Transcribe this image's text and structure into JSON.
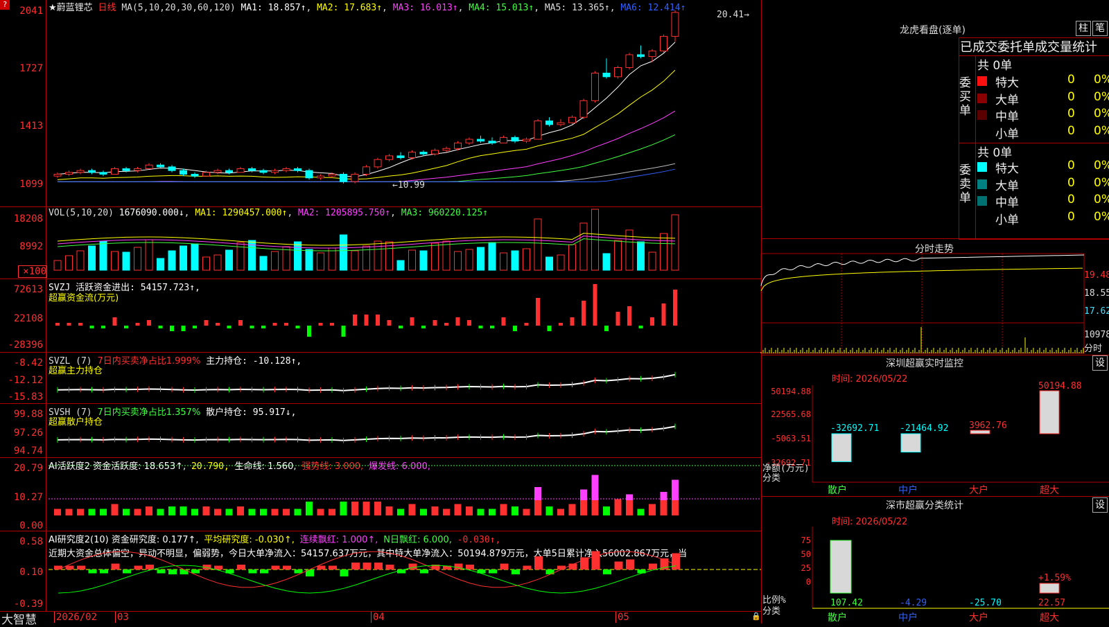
{
  "header": {
    "stock_name": "★蔚蓝锂芯",
    "period": "日线",
    "ma_label": "MA(5,10,20,30,60,120)",
    "ma1": "MA1: 18.857↑",
    "ma2": "MA2: 17.683↑",
    "ma3": "MA3: 16.013↑",
    "ma4": "MA4: 15.013↑",
    "ma5": "MA5: 13.365↑",
    "ma6": "MA6: 12.414↑",
    "high_marker": "20.41",
    "low_marker": "10.99"
  },
  "price_axis": [
    "2041",
    "1727",
    "1413",
    "1099"
  ],
  "vol": {
    "title": "VOL(5,10,20)",
    "value": "1676090.000↓",
    "ma1": "MA1: 1290457.000↑",
    "ma2": "MA2: 1205895.750↑",
    "ma3": "MA3: 960220.125↑",
    "axis": [
      "18208",
      "8992",
      "×100"
    ]
  },
  "svzj": {
    "title": "SVZJ  活跃资金进出: 54157.723↑,",
    "subtitle": "超赢资金流(万元)",
    "axis": [
      "72613",
      "22108",
      "-28396"
    ]
  },
  "svzl": {
    "title": "SVZL (7)",
    "green": "7日内买卖净占比1.999%",
    "white": "主力持仓: -10.128↑,",
    "subtitle": "超赢主力持仓",
    "axis": [
      "-8.42",
      "-12.12",
      "-15.83"
    ]
  },
  "svsh": {
    "title": "SVSH (7)",
    "green": "7日内买卖净占比1.357%",
    "white": "散户持仓: 95.917↓,",
    "subtitle": "超赢散户持仓",
    "axis": [
      "99.88",
      "97.26",
      "94.74"
    ]
  },
  "ai_active": {
    "title": "AI活跃度2 资金活跃度: 18.653↑,",
    "v2": "20.790,",
    "v3": "生命线: 1.560,",
    "v4": "强势线: 3.000,",
    "v5": "爆发线: 6.000,",
    "axis": [
      "20.79",
      "10.27",
      "0.00"
    ]
  },
  "ai_research": {
    "title": "AI研究度2(10) 资金研究度: 0.177↑,",
    "v2": "平均研究度: -0.030↑,",
    "v3": "连续飘红: 1.000↑,",
    "v4": "N日飘红: 6.000,",
    "v5": "-0.030↑,",
    "summary": "近期大资金总体偏空，异动不明显，偏弱势，今日大单净流入：54157.637万元，其中特大单净流入：50194.879万元，大单5日累计净入56002.867万元，当",
    "axis": [
      "0.58",
      "0.10",
      "-0.39"
    ]
  },
  "bottom": {
    "app": "大智慧",
    "dates": [
      "2026/02",
      "03",
      "04",
      "05"
    ]
  },
  "right": {
    "dragon_title": "龙虎看盘(逐单)",
    "btn_zhu": "柱",
    "btn_bi": "笔",
    "order_header": "已成交委托单成交量统计",
    "buy_label": "委买单",
    "sell_label": "委卖单",
    "buy_total": "共 0单",
    "sell_total": "共 0单",
    "rows": [
      {
        "name": "特大",
        "count": "0",
        "pct": "0%"
      },
      {
        "name": "大单",
        "count": "0",
        "pct": "0%"
      },
      {
        "name": "中单",
        "count": "0",
        "pct": "0%"
      },
      {
        "name": "小单",
        "count": "0",
        "pct": "0%"
      }
    ],
    "minute_title": "分时走势",
    "minute_axis": [
      "19.48",
      "18.55",
      "17.62",
      "10978",
      "分时"
    ],
    "sz_title": "深圳超赢实时监控",
    "sz_time": "时间: 2026/05/22",
    "sz_axis": [
      "50194.88",
      "22565.68",
      "-5063.51",
      "-32692.71"
    ],
    "sz_unit1": "净额(万元)",
    "sz_unit2": "分类",
    "sz_values": [
      "-32692.71",
      "-21464.92",
      "3962.76",
      "50194.88"
    ],
    "sz_cats": [
      "散户",
      "中户",
      "大户",
      "超大"
    ],
    "set": "设",
    "stat_title": "深市超赢分类统计",
    "stat_time": "时间: 2026/05/22",
    "stat_axis": [
      "75",
      "50",
      "25",
      "0"
    ],
    "stat_unit1": "比例%",
    "stat_unit2": "分类",
    "stat_values": [
      "107.42",
      "-4.29",
      "-25.70",
      "22.57"
    ],
    "stat_pct": "+1.59%",
    "stat_cats": [
      "散户",
      "中户",
      "大户",
      "超大"
    ]
  },
  "chart_data": {
    "type": "candlestick",
    "candles": [
      [
        11.4,
        11.6,
        11.3,
        11.5
      ],
      [
        11.5,
        11.7,
        11.4,
        11.6
      ],
      [
        11.6,
        11.8,
        11.5,
        11.7
      ],
      [
        11.7,
        11.8,
        11.5,
        11.6
      ],
      [
        11.6,
        11.7,
        11.4,
        11.5
      ],
      [
        11.5,
        11.9,
        11.5,
        11.8
      ],
      [
        11.8,
        11.9,
        11.6,
        11.7
      ],
      [
        11.7,
        11.9,
        11.6,
        11.8
      ],
      [
        11.8,
        12.1,
        11.8,
        12.0
      ],
      [
        12.0,
        12.1,
        11.8,
        11.9
      ],
      [
        11.9,
        12.0,
        11.6,
        11.7
      ],
      [
        11.7,
        11.8,
        11.4,
        11.5
      ],
      [
        11.5,
        11.6,
        11.3,
        11.4
      ],
      [
        11.4,
        11.7,
        11.4,
        11.6
      ],
      [
        11.6,
        11.8,
        11.5,
        11.7
      ],
      [
        11.7,
        11.8,
        11.5,
        11.6
      ],
      [
        11.6,
        11.9,
        11.6,
        11.8
      ],
      [
        11.8,
        11.9,
        11.6,
        11.7
      ],
      [
        11.7,
        11.8,
        11.5,
        11.6
      ],
      [
        11.6,
        11.8,
        11.5,
        11.7
      ],
      [
        11.7,
        11.9,
        11.6,
        11.8
      ],
      [
        11.8,
        11.9,
        11.6,
        11.7
      ],
      [
        11.7,
        11.8,
        11.2,
        11.3
      ],
      [
        11.3,
        11.5,
        11.2,
        11.4
      ],
      [
        11.4,
        11.6,
        11.3,
        11.5
      ],
      [
        11.5,
        11.6,
        11.0,
        11.1
      ],
      [
        11.1,
        11.6,
        11.0,
        11.5
      ],
      [
        11.5,
        12.0,
        11.4,
        11.9
      ],
      [
        11.9,
        12.4,
        11.8,
        12.3
      ],
      [
        12.3,
        12.6,
        12.2,
        12.5
      ],
      [
        12.5,
        12.7,
        12.3,
        12.4
      ],
      [
        12.4,
        12.8,
        12.3,
        12.7
      ],
      [
        12.7,
        12.8,
        12.5,
        12.6
      ],
      [
        12.6,
        12.9,
        12.5,
        12.8
      ],
      [
        12.8,
        13.0,
        12.7,
        12.9
      ],
      [
        12.9,
        13.3,
        12.8,
        13.2
      ],
      [
        13.2,
        13.5,
        13.1,
        13.4
      ],
      [
        13.4,
        13.6,
        13.2,
        13.3
      ],
      [
        13.3,
        13.5,
        13.1,
        13.2
      ],
      [
        13.2,
        13.6,
        13.2,
        13.5
      ],
      [
        13.5,
        13.6,
        13.2,
        13.3
      ],
      [
        13.3,
        13.5,
        13.2,
        13.4
      ],
      [
        13.4,
        14.5,
        13.4,
        14.4
      ],
      [
        14.4,
        14.6,
        14.1,
        14.2
      ],
      [
        14.2,
        14.5,
        14.1,
        14.3
      ],
      [
        14.3,
        14.7,
        14.2,
        14.6
      ],
      [
        14.6,
        15.6,
        14.5,
        15.5
      ],
      [
        15.5,
        17.1,
        15.4,
        17.0
      ],
      [
        17.0,
        17.8,
        16.7,
        16.8
      ],
      [
        16.8,
        17.4,
        16.7,
        17.3
      ],
      [
        17.3,
        18.1,
        17.2,
        18.0
      ],
      [
        18.0,
        18.5,
        17.8,
        17.9
      ],
      [
        17.9,
        18.3,
        17.6,
        18.2
      ],
      [
        18.2,
        19.1,
        18.1,
        19.0
      ],
      [
        19.0,
        20.41,
        18.7,
        20.3
      ]
    ]
  }
}
